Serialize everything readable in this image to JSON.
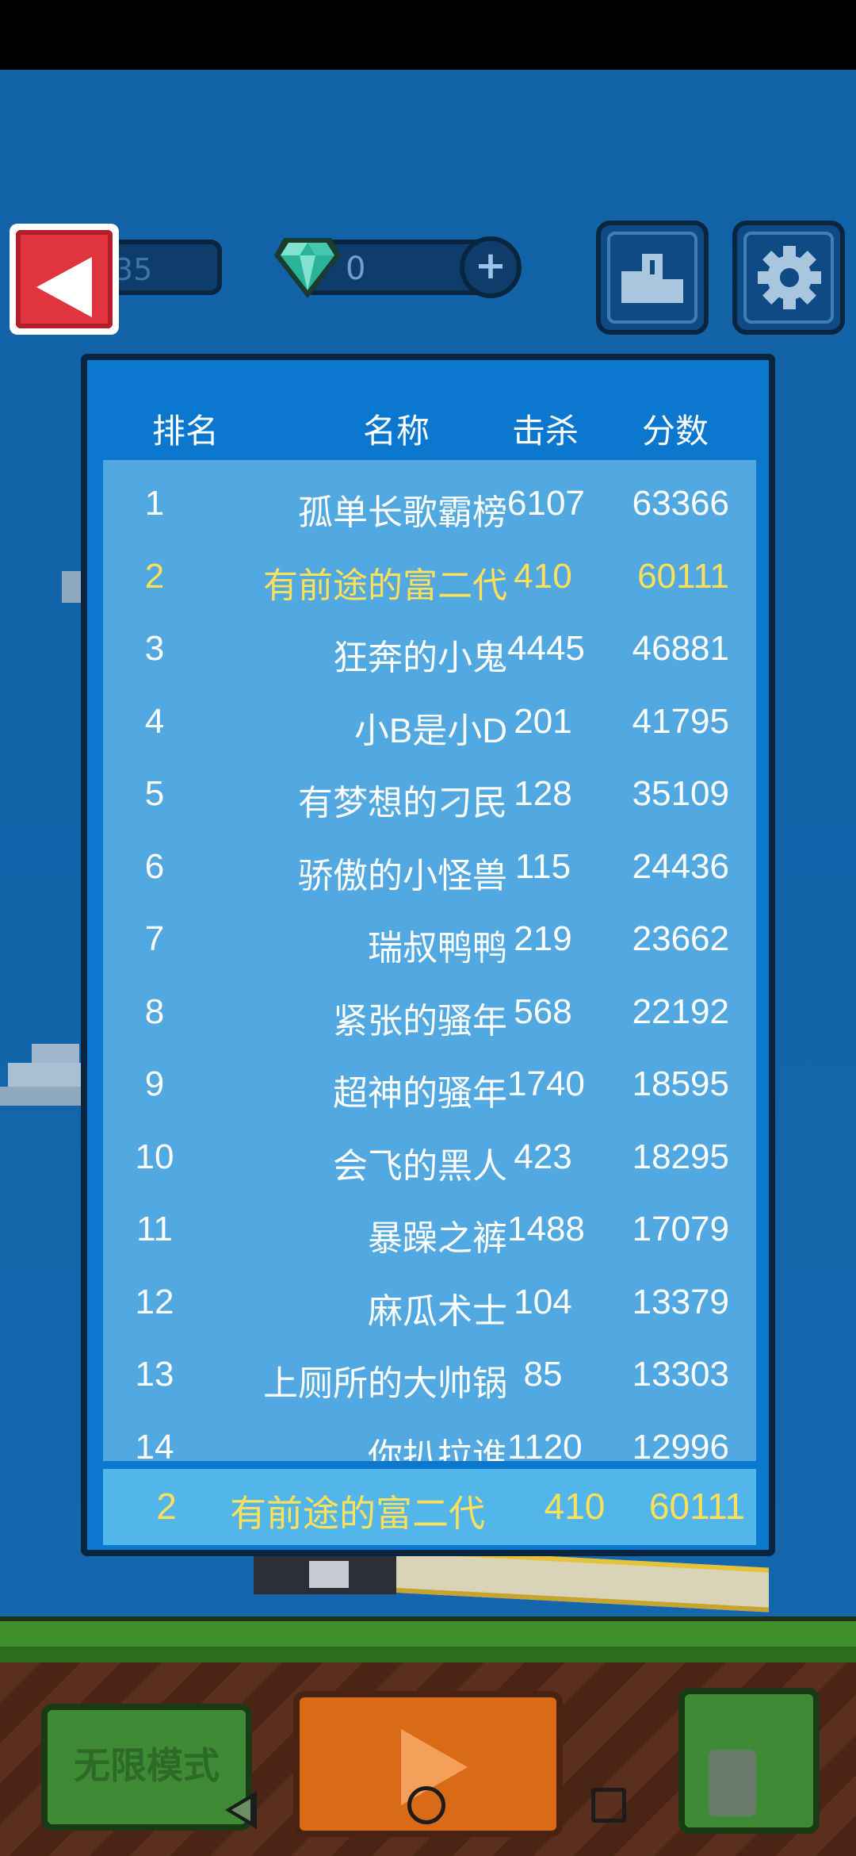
{
  "hud": {
    "coins_partial": "35",
    "gems": "0",
    "plus_label": "+"
  },
  "leaderboard": {
    "headers": {
      "rank": "排名",
      "name": "名称",
      "kills": "击杀",
      "score": "分数"
    },
    "rows": [
      {
        "rank": "1",
        "name": "孤单长歌霸榜",
        "kills": "6107",
        "score": "63366",
        "me": false
      },
      {
        "rank": "2",
        "name": "有前途的富二代",
        "kills": "410",
        "score": "60111",
        "me": true
      },
      {
        "rank": "3",
        "name": "狂奔的小鬼",
        "kills": "4445",
        "score": "46881",
        "me": false
      },
      {
        "rank": "4",
        "name": "小B是小D",
        "kills": "201",
        "score": "41795",
        "me": false
      },
      {
        "rank": "5",
        "name": "有梦想的刁民",
        "kills": "128",
        "score": "35109",
        "me": false
      },
      {
        "rank": "6",
        "name": "骄傲的小怪兽",
        "kills": "115",
        "score": "24436",
        "me": false
      },
      {
        "rank": "7",
        "name": "瑞叔鸭鸭",
        "kills": "219",
        "score": "23662",
        "me": false
      },
      {
        "rank": "8",
        "name": "紧张的骚年",
        "kills": "568",
        "score": "22192",
        "me": false
      },
      {
        "rank": "9",
        "name": "超神的骚年",
        "kills": "1740",
        "score": "18595",
        "me": false
      },
      {
        "rank": "10",
        "name": "会飞的黑人",
        "kills": "423",
        "score": "18295",
        "me": false
      },
      {
        "rank": "11",
        "name": "暴躁之裤",
        "kills": "1488",
        "score": "17079",
        "me": false
      },
      {
        "rank": "12",
        "name": "麻瓜术士",
        "kills": "104",
        "score": "13379",
        "me": false
      },
      {
        "rank": "13",
        "name": "上厕所的大帅锅",
        "kills": "85",
        "score": "13303",
        "me": false
      },
      {
        "rank": "14",
        "name": "你扒拉谁",
        "kills": "1120",
        "score": "12996",
        "me": false
      }
    ],
    "mine": {
      "rank": "2",
      "name": "有前途的富二代",
      "kills": "410",
      "score": "60111"
    }
  },
  "bottom": {
    "mode_label": "无限模式"
  },
  "colors": {
    "sky": "#1565a8",
    "panel": "#0b77cf",
    "list": "#52a8e0",
    "highlight_text": "#fde05a",
    "back_button": "#e0343f",
    "play_button": "#d96a16"
  },
  "icons": [
    "back-arrow-icon",
    "diamond-icon",
    "plus-icon",
    "podium-icon",
    "gear-icon",
    "play-icon",
    "potion-icon",
    "nav-back-icon",
    "nav-home-icon",
    "nav-recents-icon"
  ]
}
